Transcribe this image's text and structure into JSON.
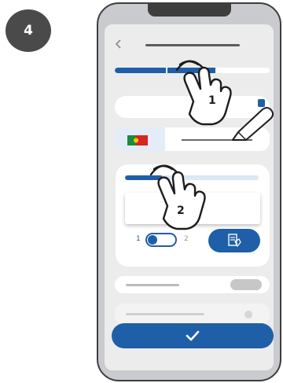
{
  "step": {
    "number": "4"
  },
  "form": {
    "progress_fraction": 0.65,
    "card_progress_fraction": 0.28,
    "country_flag": "Portugal",
    "toggle": {
      "left_label": "1",
      "right_label": "2",
      "state": "left"
    }
  },
  "gestures": {
    "tap_1_label": "1",
    "tap_2_label": "2"
  },
  "colors": {
    "accent": "#1f5fa8",
    "badge": "#4a4a4a",
    "phone_frame": "#3e3e3e"
  }
}
